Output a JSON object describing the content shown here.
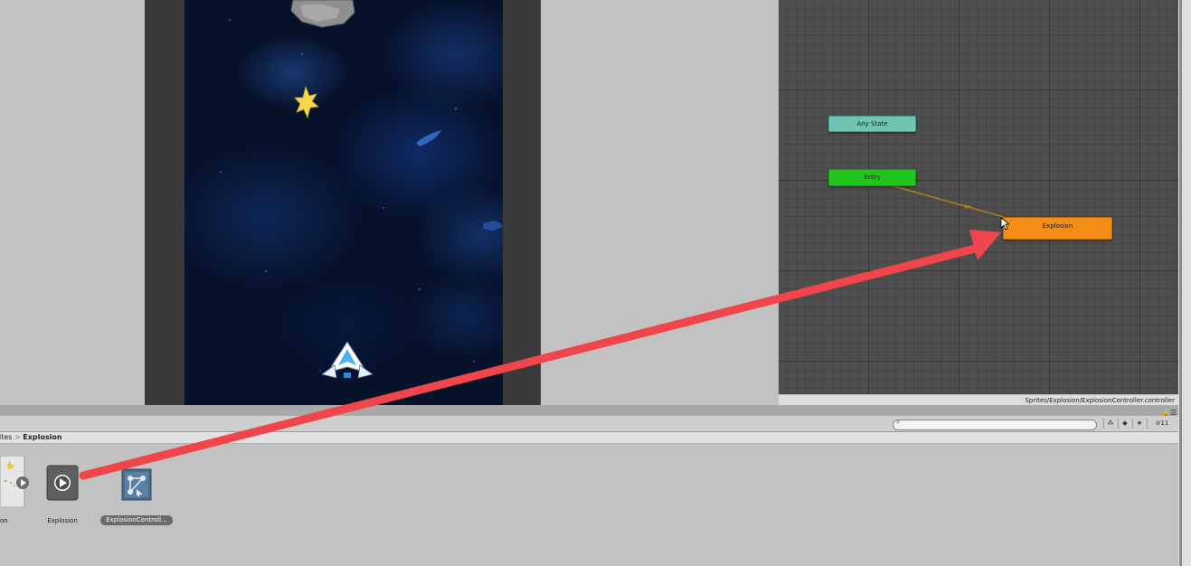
{
  "game_view": {
    "elements": [
      "asteroid",
      "explosion-sprite",
      "player-ship"
    ]
  },
  "animator": {
    "states": {
      "any_state": "Any State",
      "entry": "Entry",
      "explosion": "Explosion"
    },
    "footer_path": "Sprites/Explosion/ExplosionController.controller",
    "colors": {
      "any_state": "#6fc4b3",
      "entry": "#22c51d",
      "explosion": "#f28d16",
      "transition": "#b07a1a"
    }
  },
  "project": {
    "breadcrumb": {
      "parent": "ites",
      "separator": ">",
      "current": "Explosion"
    },
    "toolbar": {
      "search_placeholder": "",
      "hidden_count": "11"
    },
    "assets": [
      {
        "label": "on",
        "icon": "sprite-sheet-icon"
      },
      {
        "label": "Explosion",
        "icon": "animation-clip-icon"
      },
      {
        "label": "ExplosionControll...",
        "icon": "animator-controller-icon"
      }
    ]
  },
  "annotation": {
    "color": "#f0454a",
    "icon": "red-arrow"
  }
}
